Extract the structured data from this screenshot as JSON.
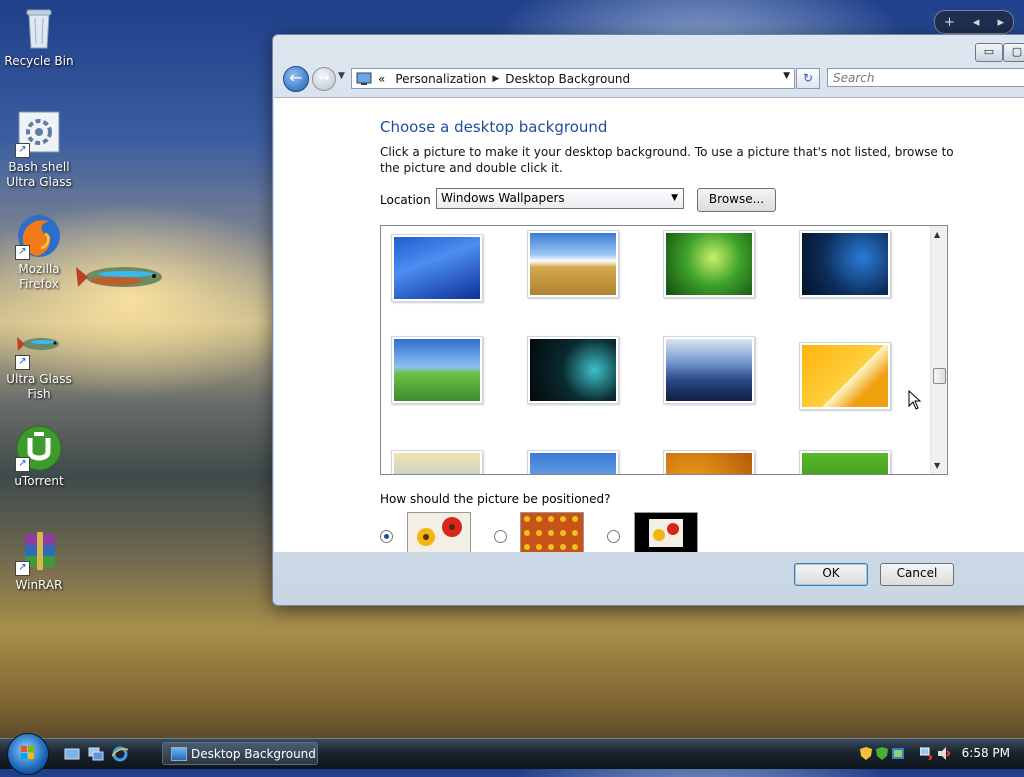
{
  "desktop": {
    "icons": [
      {
        "label": "Recycle Bin"
      },
      {
        "label": "Bash shell Ultra Glass"
      },
      {
        "label": "Mozilla Firefox"
      },
      {
        "label": "Ultra Glass Fish"
      },
      {
        "label": "uTorrent"
      },
      {
        "label": "WinRAR"
      }
    ]
  },
  "window": {
    "breadcrumb": [
      "Personalization",
      "Desktop Background"
    ],
    "breadcrumb_prefix": "«",
    "search_placeholder": "Search",
    "heading": "Choose a desktop background",
    "description": "Click a picture to make it your desktop background. To use a picture that's not listed, browse to the picture and double click it.",
    "location_label": "Location",
    "location_value": "Windows Wallpapers",
    "browse_label": "Browse...",
    "position_label": "How should the picture be positioned?",
    "ok_label": "OK",
    "cancel_label": "Cancel"
  },
  "taskbar": {
    "task_label": "Desktop Background",
    "clock": "6:58 PM"
  },
  "colors": {
    "accent": "#1e4e9a",
    "taskbar": "#1b2530"
  }
}
